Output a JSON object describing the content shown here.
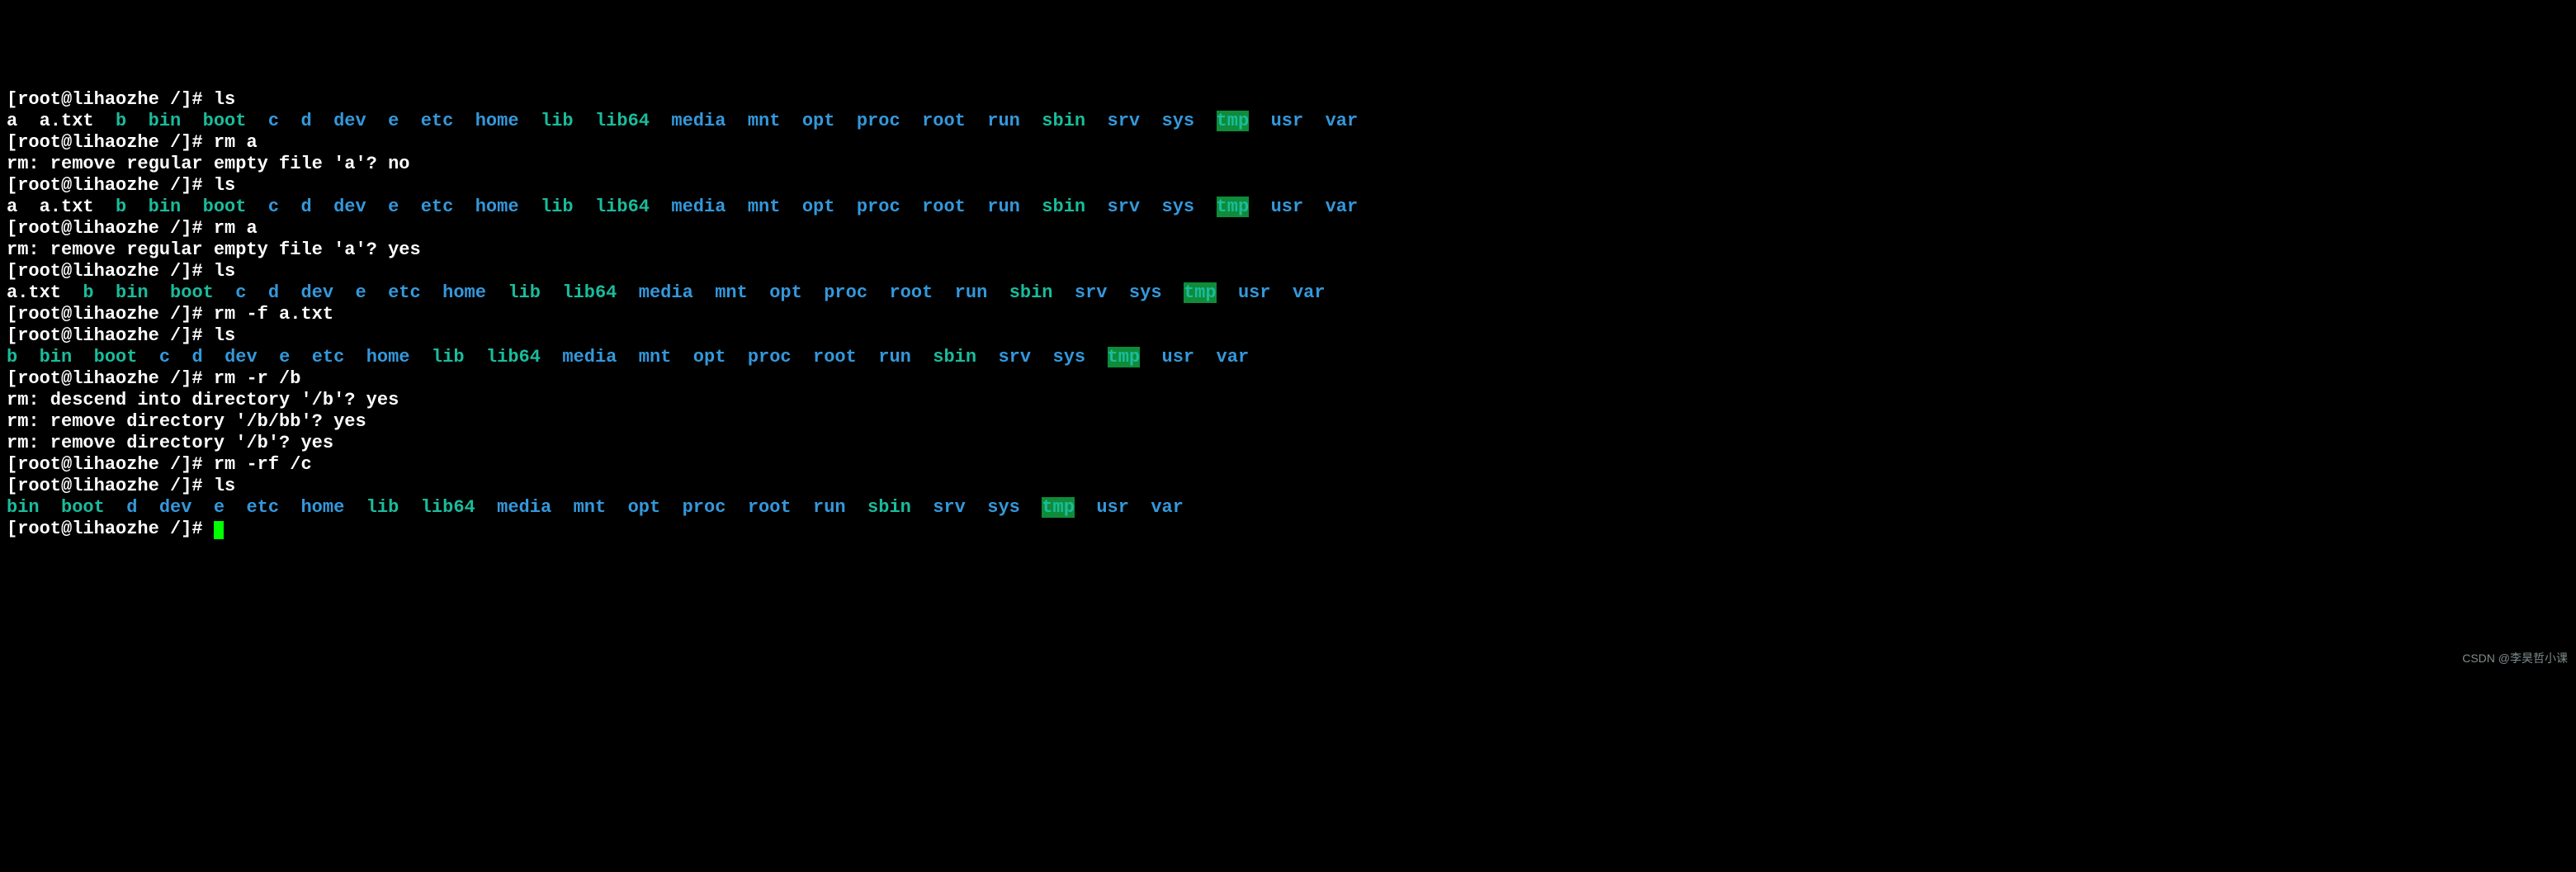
{
  "prompt": "[root@lihaozhe /]# ",
  "watermark": "CSDN @李昊哲小课",
  "listings": {
    "ls1": [
      {
        "t": "a",
        "c": "p"
      },
      {
        "t": "a.txt",
        "c": "p"
      },
      {
        "t": "b",
        "c": "x"
      },
      {
        "t": "bin",
        "c": "x"
      },
      {
        "t": "boot",
        "c": "x"
      },
      {
        "t": "c",
        "c": "d"
      },
      {
        "t": "d",
        "c": "d"
      },
      {
        "t": "dev",
        "c": "d"
      },
      {
        "t": "e",
        "c": "d"
      },
      {
        "t": "etc",
        "c": "d"
      },
      {
        "t": "home",
        "c": "d"
      },
      {
        "t": "lib",
        "c": "x"
      },
      {
        "t": "lib64",
        "c": "x"
      },
      {
        "t": "media",
        "c": "d"
      },
      {
        "t": "mnt",
        "c": "d"
      },
      {
        "t": "opt",
        "c": "d"
      },
      {
        "t": "proc",
        "c": "d"
      },
      {
        "t": "root",
        "c": "d"
      },
      {
        "t": "run",
        "c": "d"
      },
      {
        "t": "sbin",
        "c": "x"
      },
      {
        "t": "srv",
        "c": "d"
      },
      {
        "t": "sys",
        "c": "d"
      },
      {
        "t": "tmp",
        "c": "h"
      },
      {
        "t": "usr",
        "c": "d"
      },
      {
        "t": "var",
        "c": "d"
      }
    ],
    "ls2": [
      {
        "t": "a",
        "c": "p"
      },
      {
        "t": "a.txt",
        "c": "p"
      },
      {
        "t": "b",
        "c": "x"
      },
      {
        "t": "bin",
        "c": "x"
      },
      {
        "t": "boot",
        "c": "x"
      },
      {
        "t": "c",
        "c": "d"
      },
      {
        "t": "d",
        "c": "d"
      },
      {
        "t": "dev",
        "c": "d"
      },
      {
        "t": "e",
        "c": "d"
      },
      {
        "t": "etc",
        "c": "d"
      },
      {
        "t": "home",
        "c": "d"
      },
      {
        "t": "lib",
        "c": "x"
      },
      {
        "t": "lib64",
        "c": "x"
      },
      {
        "t": "media",
        "c": "d"
      },
      {
        "t": "mnt",
        "c": "d"
      },
      {
        "t": "opt",
        "c": "d"
      },
      {
        "t": "proc",
        "c": "d"
      },
      {
        "t": "root",
        "c": "d"
      },
      {
        "t": "run",
        "c": "d"
      },
      {
        "t": "sbin",
        "c": "x"
      },
      {
        "t": "srv",
        "c": "d"
      },
      {
        "t": "sys",
        "c": "d"
      },
      {
        "t": "tmp",
        "c": "h"
      },
      {
        "t": "usr",
        "c": "d"
      },
      {
        "t": "var",
        "c": "d"
      }
    ],
    "ls3": [
      {
        "t": "a.txt",
        "c": "p"
      },
      {
        "t": "b",
        "c": "x"
      },
      {
        "t": "bin",
        "c": "x"
      },
      {
        "t": "boot",
        "c": "x"
      },
      {
        "t": "c",
        "c": "d"
      },
      {
        "t": "d",
        "c": "d"
      },
      {
        "t": "dev",
        "c": "d"
      },
      {
        "t": "e",
        "c": "d"
      },
      {
        "t": "etc",
        "c": "d"
      },
      {
        "t": "home",
        "c": "d"
      },
      {
        "t": "lib",
        "c": "x"
      },
      {
        "t": "lib64",
        "c": "x"
      },
      {
        "t": "media",
        "c": "d"
      },
      {
        "t": "mnt",
        "c": "d"
      },
      {
        "t": "opt",
        "c": "d"
      },
      {
        "t": "proc",
        "c": "d"
      },
      {
        "t": "root",
        "c": "d"
      },
      {
        "t": "run",
        "c": "d"
      },
      {
        "t": "sbin",
        "c": "x"
      },
      {
        "t": "srv",
        "c": "d"
      },
      {
        "t": "sys",
        "c": "d"
      },
      {
        "t": "tmp",
        "c": "h"
      },
      {
        "t": "usr",
        "c": "d"
      },
      {
        "t": "var",
        "c": "d"
      }
    ],
    "ls4": [
      {
        "t": "b",
        "c": "x"
      },
      {
        "t": "bin",
        "c": "x"
      },
      {
        "t": "boot",
        "c": "x"
      },
      {
        "t": "c",
        "c": "d"
      },
      {
        "t": "d",
        "c": "d"
      },
      {
        "t": "dev",
        "c": "d"
      },
      {
        "t": "e",
        "c": "d"
      },
      {
        "t": "etc",
        "c": "d"
      },
      {
        "t": "home",
        "c": "d"
      },
      {
        "t": "lib",
        "c": "x"
      },
      {
        "t": "lib64",
        "c": "x"
      },
      {
        "t": "media",
        "c": "d"
      },
      {
        "t": "mnt",
        "c": "d"
      },
      {
        "t": "opt",
        "c": "d"
      },
      {
        "t": "proc",
        "c": "d"
      },
      {
        "t": "root",
        "c": "d"
      },
      {
        "t": "run",
        "c": "d"
      },
      {
        "t": "sbin",
        "c": "x"
      },
      {
        "t": "srv",
        "c": "d"
      },
      {
        "t": "sys",
        "c": "d"
      },
      {
        "t": "tmp",
        "c": "h"
      },
      {
        "t": "usr",
        "c": "d"
      },
      {
        "t": "var",
        "c": "d"
      }
    ],
    "ls5": [
      {
        "t": "bin",
        "c": "x"
      },
      {
        "t": "boot",
        "c": "x"
      },
      {
        "t": "d",
        "c": "d"
      },
      {
        "t": "dev",
        "c": "d"
      },
      {
        "t": "e",
        "c": "d"
      },
      {
        "t": "etc",
        "c": "d"
      },
      {
        "t": "home",
        "c": "d"
      },
      {
        "t": "lib",
        "c": "x"
      },
      {
        "t": "lib64",
        "c": "x"
      },
      {
        "t": "media",
        "c": "d"
      },
      {
        "t": "mnt",
        "c": "d"
      },
      {
        "t": "opt",
        "c": "d"
      },
      {
        "t": "proc",
        "c": "d"
      },
      {
        "t": "root",
        "c": "d"
      },
      {
        "t": "run",
        "c": "d"
      },
      {
        "t": "sbin",
        "c": "x"
      },
      {
        "t": "srv",
        "c": "d"
      },
      {
        "t": "sys",
        "c": "d"
      },
      {
        "t": "tmp",
        "c": "h"
      },
      {
        "t": "usr",
        "c": "d"
      },
      {
        "t": "var",
        "c": "d"
      }
    ]
  },
  "lines": [
    {
      "type": "cmd",
      "cmd": "ls"
    },
    {
      "type": "listing",
      "ref": "ls1"
    },
    {
      "type": "cmd",
      "cmd": "rm a"
    },
    {
      "type": "out",
      "text": "rm: remove regular empty file 'a'? no"
    },
    {
      "type": "cmd",
      "cmd": "ls"
    },
    {
      "type": "listing",
      "ref": "ls2"
    },
    {
      "type": "cmd",
      "cmd": "rm a"
    },
    {
      "type": "out",
      "text": "rm: remove regular empty file 'a'? yes"
    },
    {
      "type": "cmd",
      "cmd": "ls"
    },
    {
      "type": "listing",
      "ref": "ls3"
    },
    {
      "type": "cmd",
      "cmd": "rm -f a.txt"
    },
    {
      "type": "cmd",
      "cmd": "ls"
    },
    {
      "type": "listing",
      "ref": "ls4"
    },
    {
      "type": "cmd",
      "cmd": "rm -r /b"
    },
    {
      "type": "out",
      "text": "rm: descend into directory '/b'? yes"
    },
    {
      "type": "out",
      "text": "rm: remove directory '/b/bb'? yes"
    },
    {
      "type": "out",
      "text": "rm: remove directory '/b'? yes"
    },
    {
      "type": "cmd",
      "cmd": "rm -rf /c"
    },
    {
      "type": "cmd",
      "cmd": "ls"
    },
    {
      "type": "listing",
      "ref": "ls5"
    },
    {
      "type": "cmd",
      "cmd": "",
      "cursor": true
    }
  ]
}
